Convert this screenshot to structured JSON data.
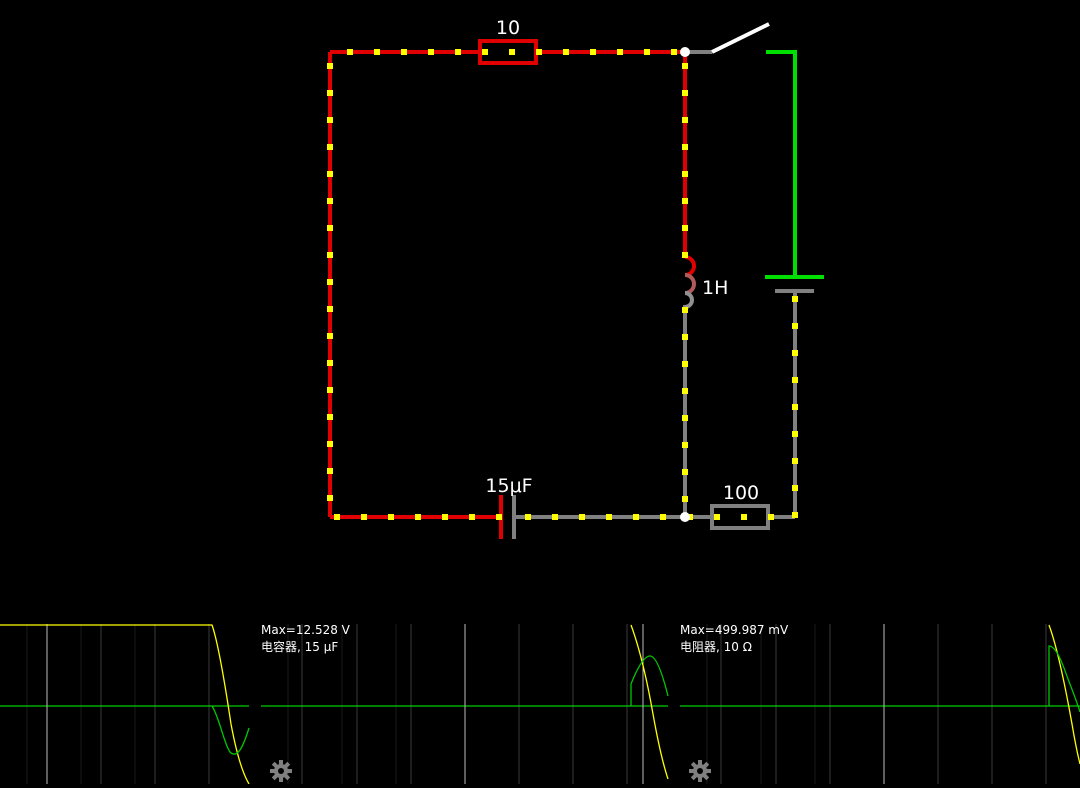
{
  "colors": {
    "background": "#000000",
    "wire_active": "#e00000",
    "wire_inactive": "#808080",
    "wire_green": "#00e000",
    "current_dot": "#ffff00",
    "scope_grid": "#3a3a3a",
    "trace_voltage": "#ffff00",
    "trace_current": "#00c800",
    "scope_axis": "#00ff00"
  },
  "components": {
    "top_resistor": {
      "value": "10"
    },
    "inductor": {
      "value": "1H"
    },
    "capacitor": {
      "value": "15μF"
    },
    "bottom_resistor": {
      "value": "100"
    }
  },
  "scopes": [
    {
      "max": "Max=12.528 V",
      "name": "电容器, 15 μF",
      "settings_icon": "gear-icon"
    },
    {
      "max": "Max=499.987 mV",
      "name": "电阻器, 10 Ω",
      "settings_icon": "gear-icon"
    }
  ]
}
